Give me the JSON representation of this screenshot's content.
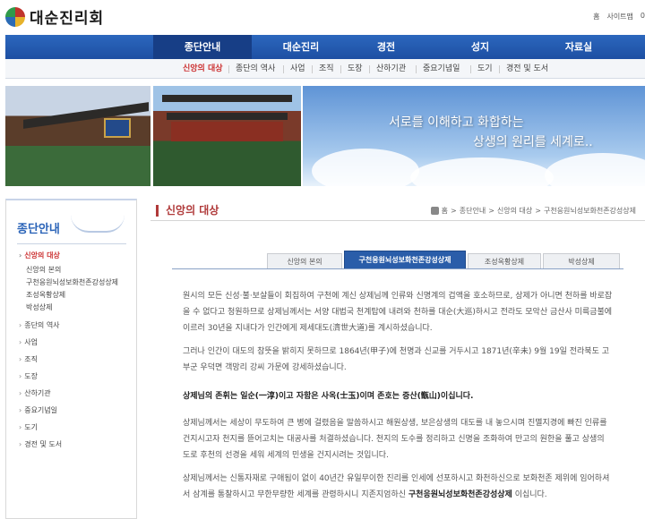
{
  "header": {
    "logo_text": "대순진리회",
    "util_links": [
      "홈",
      "사이트맵",
      "0"
    ]
  },
  "gnb": {
    "items": [
      "종단안내",
      "대순진리",
      "경전",
      "성지",
      "자료실"
    ]
  },
  "subnav": {
    "items": [
      "신앙의 대상",
      "종단의 역사",
      "사업",
      "조직",
      "도장",
      "산하기관",
      "중요기념일",
      "도기",
      "경전 및 도서"
    ]
  },
  "banner": {
    "line1": "서로를 이해하고 화합하는",
    "line2": "상생의 원리를 세계로.."
  },
  "lnb": {
    "title": "종단안내",
    "active_item": "신앙의 대상",
    "sub_items": [
      "신앙의 본의",
      "구천응원뇌성보화천존강성상제",
      "조성옥황상제",
      "박성상제"
    ],
    "items": [
      "종단의 역사",
      "사업",
      "조직",
      "도장",
      "산하기관",
      "중요기념일",
      "도기",
      "경전 및 도서"
    ]
  },
  "content": {
    "page_title": "신앙의 대상",
    "breadcrumb": [
      "홈",
      "종단안내",
      "신앙의 대상",
      "구천응원뇌성보화천존강성상제"
    ],
    "tabs": [
      "신앙의 본의",
      "구천응원뇌성보화천존강성상제",
      "조성옥황상제",
      "박성상제"
    ],
    "paragraphs": [
      "원시의 모든 신성·불·보살들이 회집하여 구천에 계신 상제님께 인류와 신명계의 겁액을 호소하므로, 상제가 아니면 천하를 바로잡을 수 없다고 청원하므로 상제님께서는 서양 대법국 천계탑에 내려와 천하를 대순(大巡)하시고 전라도 모악산 금산사 미륵금불에 이르러 30년을 지내다가 인간에게 제세대도(濟世大道)를 계시하셨습니다.",
      "그러나 인간이 대도의 참뜻을 밝히지 못하므로 1864년(甲子)에 천명과 신교를 거두시고 1871년(辛未) 9월 19일 전라북도 고부군 우덕면 객망리 강씨 가문에 강세하셨습니다.",
      "상제님의 존휘는 일순(一淳)이고 자함은 사옥(士玉)이며 존호는 증산(甑山)이십니다.",
      "상제님께서는 세상이 무도하여 큰 병에 걸렸음을 말씀하시고 해원상생, 보은상생의 대도를 내 놓으시며 진멸지경에 빠진 인류를 건지시고자 천지를 뜯어고치는 대공사를 처결하셨습니다. 천지의 도수를 정리하고 신명을 조화하여 만고의 원한을 풀고 상생의 도로 후천의 선경을 세워 세계의 민생을 건지시려는 것입니다.",
      "상제님께서는 신통자재로 구애됨이 없이 40년간 유일무이한 진리를 인세에 선포하시고 화천하신으로 보화천존 제위에 임어하셔서 삼계를 통찰하시고 무한무량한 세계를 관령하시니 지존지엄하신",
      "구천응원뇌성보화천존강성상제",
      "이십니다."
    ]
  },
  "colors": {
    "gnb_blue": "#2c67bd",
    "accent_red": "#b03a3a",
    "tab_active": "#2a5da9"
  }
}
